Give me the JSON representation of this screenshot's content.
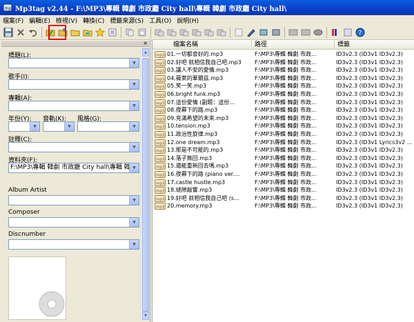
{
  "window": {
    "title": "Mp3tag v2.44  -  F:\\MP3\\專輯 韓劇 市政廳 City hall\\專輯 韓劇 市政廳 City hall\\"
  },
  "menu": [
    "檔案(F)",
    "編輯(E)",
    "檢視(V)",
    "轉換(C)",
    "標籤來源(S)",
    "工具(O)",
    "說明(H)"
  ],
  "toolbar_icons": [
    "save-icon",
    "delete-icon",
    "undo-icon",
    "folder-tag-icon",
    "open-folder-icon",
    "add-folder-icon",
    "folder-icon",
    "folder-star-icon",
    "favorite-star-icon",
    "playlist-icon",
    "copy-icon",
    "paste-icon",
    "tag-file-icon",
    "tag-file-2-icon",
    "tag-file-3-icon",
    "tag-file-4-icon",
    "tag-file-5-icon",
    "tag-file-6-icon",
    "edit-icon",
    "quick-action-icon",
    "action-icon",
    "filter-icon",
    "freedb-icon",
    "amazon-icon",
    "discogs-icon",
    "settings-icon",
    "tools-icon",
    "help-icon"
  ],
  "left_panel": {
    "title_label": "標題(L):",
    "artist_label": "歌手(I):",
    "album_label": "專輯(A):",
    "year_label": "年份(Y):",
    "track_label": "音軌(K):",
    "genre_label": "風格(G):",
    "comment_label": "註釋(C):",
    "directory_label": "資料夾(F):",
    "directory_value": "F:\\MP3\\專輯 韓劇 市政廳 City hall\\專輯 韓劇 市",
    "album_artist_label": "Album Artist",
    "composer_label": "Composer",
    "discnumber_label": "Discnumber"
  },
  "table": {
    "columns": [
      "檔案名稱",
      "路徑",
      "標籤"
    ],
    "rows": [
      {
        "file": "01.一切都會好的.mp3",
        "path": "F:\\MP3\\專輯 韓劇 市政...",
        "tag": "ID3v2.3 (ID3v1 ID3v2.3)"
      },
      {
        "file": "02.好吧 就相信我自己吧.mp3",
        "path": "F:\\MP3\\專輯 韓劇 市政...",
        "tag": "ID3v2.3 (ID3v1 ID3v2.3)"
      },
      {
        "file": "03.讓人不安的愛情.mp3",
        "path": "F:\\MP3\\專輯 韓劇 市政...",
        "tag": "ID3v2.3 (ID3v1 ID3v2.3)"
      },
      {
        "file": "04.薇萊的華爾茲.mp3",
        "path": "F:\\MP3\\專輯 韓劇 市政...",
        "tag": "ID3v2.3 (ID3v1 ID3v2.3)"
      },
      {
        "file": "05.笑一笑.mp3",
        "path": "F:\\MP3\\專輯 韓劇 市政...",
        "tag": "ID3v2.3 (ID3v1 ID3v2.3)"
      },
      {
        "file": "06.bright funk.mp3",
        "path": "F:\\MP3\\專輯 韓劇 市政...",
        "tag": "ID3v2.3 (ID3v1 ID3v2.3)"
      },
      {
        "file": "07.這份愛情 (副題：這份...",
        "path": "F:\\MP3\\專輯 韓劇 市政...",
        "tag": "ID3v2.3 (ID3v1 ID3v2.3)"
      },
      {
        "file": "08.夜幕下的路.mp3",
        "path": "F:\\MP3\\專輯 韓劇 市政...",
        "tag": "ID3v2.3 (ID3v1 ID3v2.3)"
      },
      {
        "file": "09.充滿希望的未來.mp3",
        "path": "F:\\MP3\\專輯 韓劇 市政...",
        "tag": "ID3v2.3 (ID3v1 ID3v2.3)"
      },
      {
        "file": "10.tension.mp3",
        "path": "F:\\MP3\\專輯 韓劇 市政...",
        "tag": "ID3v2.3 (ID3v1 ID3v2.3)"
      },
      {
        "file": "11.政治性旋律.mp3",
        "path": "F:\\MP3\\專輯 韓劇 市政...",
        "tag": "ID3v2.3 (ID3v1 ID3v2.3)"
      },
      {
        "file": "12.one dream.mp3",
        "path": "F:\\MP3\\專輯 韓劇 市政...",
        "tag": "ID3v2.3 (ID3v1 Lyrics3v2 ..."
      },
      {
        "file": "13.那是不可能的.mp3",
        "path": "F:\\MP3\\專輯 韓劇 市政...",
        "tag": "ID3v2.3 (ID3v1 ID3v2.3)"
      },
      {
        "file": "14.落子無回.mp3",
        "path": "F:\\MP3\\專輯 韓劇 市政...",
        "tag": "ID3v2.3 (ID3v1 ID3v2.3)"
      },
      {
        "file": "15.還能重新回去嗎.mp3",
        "path": "F:\\MP3\\專輯 韓劇 市政...",
        "tag": "ID3v2.3 (ID3v1 ID3v2.3)"
      },
      {
        "file": "16.夜幕下的路 (piano ver....",
        "path": "F:\\MP3\\專輯 韓劇 市政...",
        "tag": "ID3v2.3 (ID3v1 ID3v2.3)"
      },
      {
        "file": "17.castle hustle.mp3",
        "path": "F:\\MP3\\專輯 韓劇 市政...",
        "tag": "ID3v2.3 (ID3v1 ID3v2.3)"
      },
      {
        "file": "18.縫隙敲響.mp3",
        "path": "F:\\MP3\\專輯 韓劇 市政...",
        "tag": "ID3v2.3 (ID3v1 ID3v2.3)"
      },
      {
        "file": "19.好吧 就相信我自己吧 (s...",
        "path": "F:\\MP3\\專輯 韓劇 市政...",
        "tag": "ID3v2.3 (ID3v1 ID3v2.3)"
      },
      {
        "file": "20.memory.mp3",
        "path": "F:\\MP3\\專輯 韓劇 市政...",
        "tag": "ID3v2.3 (ID3v1 ID3v2.3)"
      }
    ]
  },
  "colors": {
    "titlebar": "#0a3fc8",
    "highlight": "#e00000"
  }
}
